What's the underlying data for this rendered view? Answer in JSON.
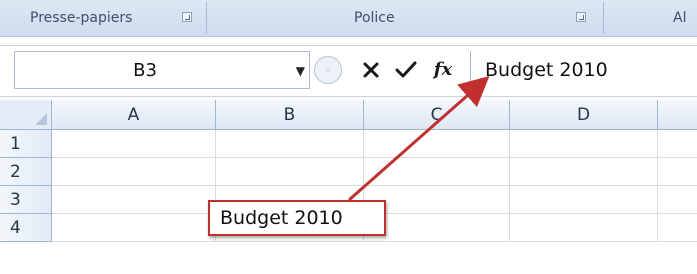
{
  "ribbon": {
    "groups": [
      {
        "label": "Presse-papiers"
      },
      {
        "label": "Police"
      },
      {
        "label": "Al"
      }
    ]
  },
  "formula_bar": {
    "name_box": "B3",
    "fx_label": "fx",
    "formula": "Budget 2010"
  },
  "grid": {
    "columns": [
      "A",
      "B",
      "C",
      "D"
    ],
    "rows": [
      "1",
      "2",
      "3",
      "4"
    ],
    "cell_B3": "Budget 2010"
  },
  "colors": {
    "annotation": "#c0302f",
    "ribbon": "#cfdcee",
    "header": "#dde8f4"
  },
  "icons": {
    "cancel": "cross-icon",
    "enter": "check-icon",
    "function": "fx-icon",
    "dropdown": "dropdown-arrow-icon"
  }
}
